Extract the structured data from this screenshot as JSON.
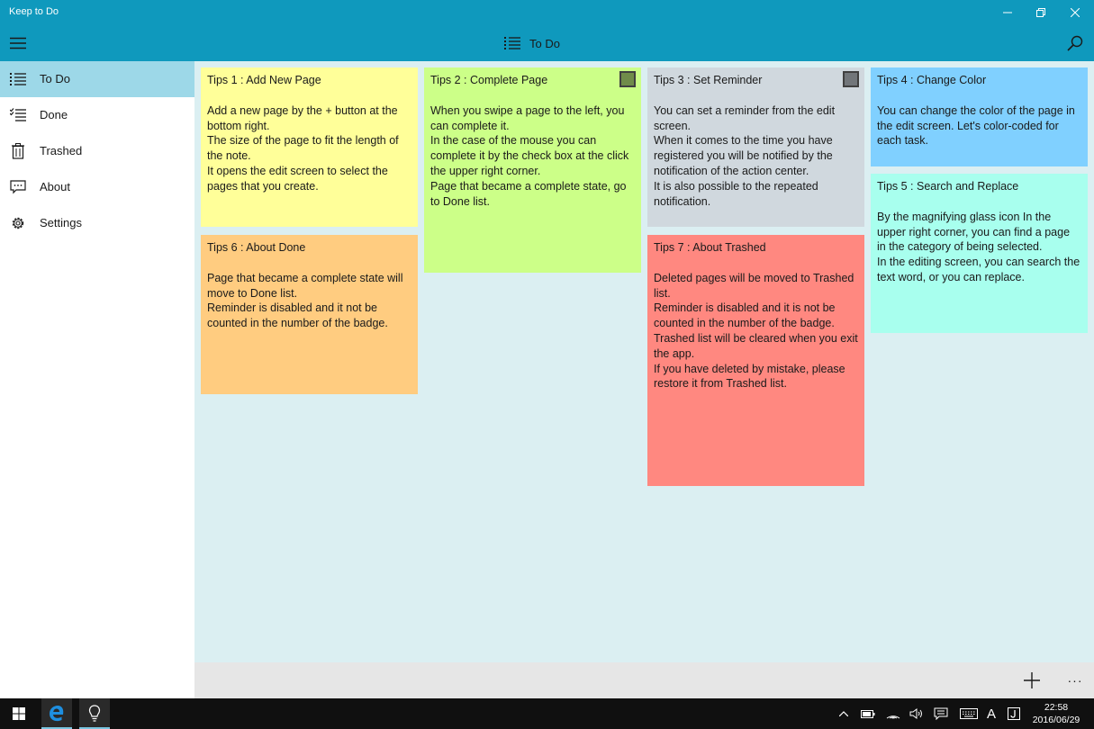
{
  "window": {
    "title": "Keep to Do"
  },
  "header": {
    "title": "To Do"
  },
  "sidebar": {
    "items": [
      {
        "label": "To Do",
        "icon": "list-icon",
        "active": true
      },
      {
        "label": "Done",
        "icon": "checklist-icon",
        "active": false
      },
      {
        "label": "Trashed",
        "icon": "trash-icon",
        "active": false
      },
      {
        "label": "About",
        "icon": "speech-bubble-icon",
        "active": false
      },
      {
        "label": "Settings",
        "icon": "gear-icon",
        "active": false
      }
    ]
  },
  "notes": [
    {
      "title": "Tips 1 : Add New Page",
      "body": "Add a new page by the + button at the bottom right.\nThe size of the page to fit the length of the note.\nIt opens the edit screen to select the pages that you create.",
      "color": "#ffff99",
      "has_check": false
    },
    {
      "title": "Tips 2 : Complete Page",
      "body": "When you swipe a page to the left, you can complete it.\nIn the case of the mouse you can complete it by the check box at the click the upper right corner.\nPage that became a complete state, go to Done list.",
      "color": "#ccff88",
      "has_check": true
    },
    {
      "title": "Tips 3 : Set Reminder",
      "body": "You can set a reminder from the edit screen.\nWhen it comes to the time you have registered you will be notified by the notification of the action center.\nIt is also possible to the repeated notification.",
      "color": "#d0d8de",
      "has_check": true
    },
    {
      "title": "Tips 4 : Change Color",
      "body": "You can change the color of the page in the edit screen. Let's color-coded for each task.",
      "color": "#80d0ff",
      "has_check": false
    },
    {
      "title": "Tips 5 : Search and Replace",
      "body": "By the magnifying glass icon In the upper right corner, you can find a page in the category of being selected.\nIn the editing screen, you can search the text word, or you can replace.",
      "color": "#a8ffee",
      "has_check": false
    },
    {
      "title": "Tips 6 : About Done",
      "body": "Page that became a complete state will move to Done list.\nReminder is disabled and it not be counted in the number of the badge.",
      "color": "#ffcc80",
      "has_check": false
    },
    {
      "title": "Tips 7 : About Trashed",
      "body": "Deleted pages will be moved to Trashed list.\nReminder is disabled and it is not be counted in the number of the badge.\nTrashed list will be cleared when you exit the app.\nIf you have deleted by mistake, please restore it from Trashed list.",
      "color": "#ff8880",
      "has_check": false
    }
  ],
  "commandbar": {
    "add_icon": "plus-icon",
    "more_label": "···"
  },
  "taskbar": {
    "time": "22:58",
    "date": "2016/06/29",
    "ime_label": "A"
  },
  "colors": {
    "accent": "#0f99bd",
    "nav_selected": "#9dd8e8",
    "board_bg": "#dbeff2"
  }
}
